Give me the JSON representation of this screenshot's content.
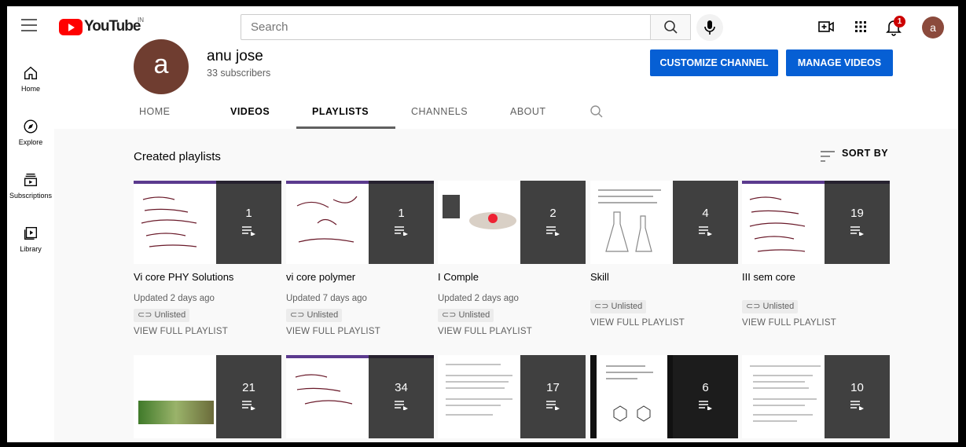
{
  "topbar": {
    "logo_text": "YouTube",
    "logo_region": "IN",
    "search_placeholder": "Search",
    "notification_count": "1",
    "avatar_letter": "a"
  },
  "sidebar": {
    "items": [
      {
        "label": "Home",
        "icon": "home-icon"
      },
      {
        "label": "Explore",
        "icon": "compass-icon"
      },
      {
        "label": "Subscriptions",
        "icon": "subscriptions-icon"
      },
      {
        "label": "Library",
        "icon": "library-icon"
      }
    ]
  },
  "channel": {
    "avatar_letter": "a",
    "name": "anu jose",
    "subscribers": "33 subscribers",
    "customize_label": "CUSTOMIZE CHANNEL",
    "manage_label": "MANAGE VIDEOS",
    "tabs": [
      "HOME",
      "VIDEOS",
      "PLAYLISTS",
      "CHANNELS",
      "ABOUT"
    ],
    "active_tab": "PLAYLISTS"
  },
  "content": {
    "section_title": "Created playlists",
    "sort_label": "SORT BY",
    "row1": [
      {
        "title": "Vi core PHY Solutions",
        "count": "1",
        "updated": "Updated 2 days ago",
        "visibility": "Unlisted",
        "link": "VIEW FULL PLAYLIST"
      },
      {
        "title": "vi core polymer",
        "count": "1",
        "updated": "Updated 7 days ago",
        "visibility": "Unlisted",
        "link": "VIEW FULL PLAYLIST"
      },
      {
        "title": "I Comple",
        "count": "2",
        "updated": "Updated 2 days ago",
        "visibility": "Unlisted",
        "link": "VIEW FULL PLAYLIST"
      },
      {
        "title": "Skill",
        "count": "4",
        "updated": "",
        "visibility": "Unlisted",
        "link": "VIEW FULL PLAYLIST"
      },
      {
        "title": "III sem core",
        "count": "19",
        "updated": "",
        "visibility": "Unlisted",
        "link": "VIEW FULL PLAYLIST"
      }
    ],
    "row2": [
      {
        "count": "21"
      },
      {
        "count": "34"
      },
      {
        "count": "17"
      },
      {
        "count": "6"
      },
      {
        "count": "10"
      }
    ]
  },
  "colors": {
    "brand_red": "#ff0000",
    "button_blue": "#065fd4",
    "text_primary": "#030303",
    "text_secondary": "#606060"
  }
}
